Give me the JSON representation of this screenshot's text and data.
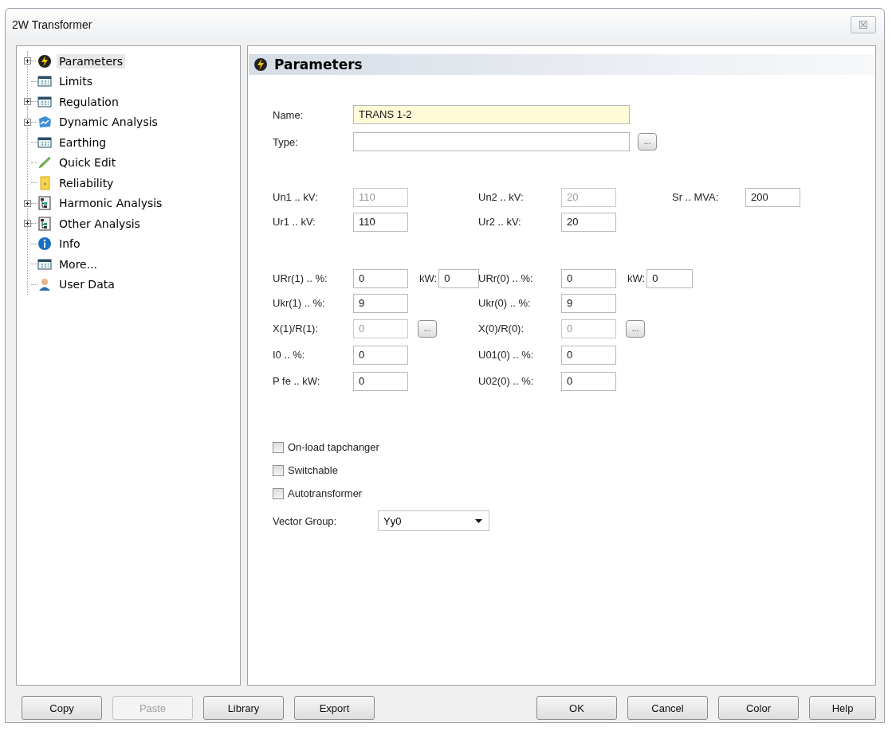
{
  "window": {
    "title": "2W Transformer",
    "close": "☒"
  },
  "tree": [
    {
      "label": "Parameters",
      "kind": "branch",
      "expanded": false,
      "selected": true
    },
    {
      "label": "Limits",
      "kind": "leaf",
      "selected": false
    },
    {
      "label": "Regulation",
      "kind": "branch",
      "expanded": false,
      "selected": false
    },
    {
      "label": "Dynamic Analysis",
      "kind": "branch",
      "expanded": false,
      "selected": false
    },
    {
      "label": "Earthing",
      "kind": "leaf",
      "selected": false
    },
    {
      "label": "Quick Edit",
      "kind": "leaf",
      "selected": false
    },
    {
      "label": "Reliability",
      "kind": "leaf",
      "selected": false
    },
    {
      "label": "Harmonic Analysis",
      "kind": "branch",
      "expanded": false,
      "selected": false
    },
    {
      "label": "Other Analysis",
      "kind": "branch",
      "expanded": false,
      "selected": false
    },
    {
      "label": "Info",
      "kind": "leaf",
      "selected": false
    },
    {
      "label": "More...",
      "kind": "leaf",
      "selected": false
    },
    {
      "label": "User Data",
      "kind": "leaf",
      "selected": false
    }
  ],
  "section": {
    "title": "Parameters"
  },
  "name_field": {
    "label": "Name:",
    "value": "TRANS 1-2",
    "focused": true
  },
  "type_field": {
    "label": "Type:",
    "browse": "..."
  },
  "field_blocks": [
    [
      [
        {
          "label": "Un1 .. kV:",
          "value": "110",
          "disabled": true
        },
        {
          "label": "Un2 .. kV:",
          "value": "20",
          "disabled": true
        },
        {
          "label": "Sr .. MVA:",
          "value": "200",
          "disabled": false
        }
      ],
      [
        {
          "label": "Ur1 .. kV:",
          "value": "110",
          "disabled": false
        },
        {
          "label": "Ur2 .. kV:",
          "value": "20",
          "disabled": false
        }
      ]
    ],
    [
      [
        {
          "label": "URr(1) .. %:",
          "value": "0",
          "disabled": false,
          "extra": {
            "kind": "field",
            "label": "kW:",
            "value": "0"
          }
        },
        {
          "label": "URr(0) .. %:",
          "value": "0",
          "disabled": false,
          "extra": {
            "kind": "field",
            "label": "kW:",
            "value": "0"
          }
        }
      ],
      [
        {
          "label": "Ukr(1) .. %:",
          "value": "9",
          "disabled": false
        },
        {
          "label": "Ukr(0) .. %:",
          "value": "9",
          "disabled": false
        }
      ],
      [
        {
          "label": "X(1)/R(1):",
          "value": "0",
          "disabled": true,
          "extra": {
            "kind": "browse",
            "label": "..."
          }
        },
        {
          "label": "X(0)/R(0):",
          "value": "0",
          "disabled": true,
          "extra": {
            "kind": "browse",
            "label": "..."
          }
        }
      ],
      [
        {
          "label": "I0 .. %:",
          "value": "0",
          "disabled": false
        },
        {
          "label": "U01(0) .. %:",
          "value": "0",
          "disabled": false
        }
      ],
      [
        {
          "label": "P fe .. kW:",
          "value": "0",
          "disabled": false
        },
        {
          "label": "U02(0) .. %:",
          "value": "0",
          "disabled": false
        }
      ]
    ]
  ],
  "checkboxes": [
    {
      "label": "On-load tapchanger",
      "checked": false
    },
    {
      "label": "Switchable",
      "checked": false
    },
    {
      "label": "Autotransformer",
      "checked": false
    }
  ],
  "vector_group": {
    "label": "Vector Group:",
    "value": "Yy0"
  },
  "buttons_left": [
    {
      "label": "Copy",
      "disabled": false
    },
    {
      "label": "Paste",
      "disabled": true
    },
    {
      "label": "Library",
      "disabled": false
    },
    {
      "label": "Export",
      "disabled": false
    }
  ],
  "buttons_right": [
    {
      "label": "OK",
      "disabled": false
    },
    {
      "label": "Cancel",
      "disabled": false
    },
    {
      "label": "Color",
      "disabled": false
    },
    {
      "label": "Help",
      "disabled": false
    }
  ]
}
